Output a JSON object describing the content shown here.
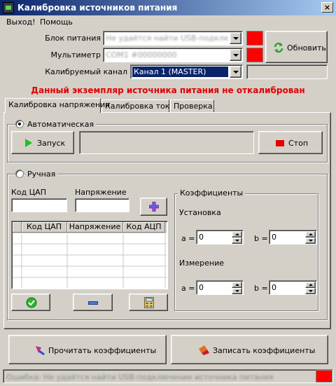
{
  "window": {
    "title": "Калибровка источников питания",
    "close": "×"
  },
  "menu": {
    "items": [
      "Выход!",
      "Помощь"
    ]
  },
  "form": {
    "psu_label": "Блок питания",
    "psu_value": "Не удаётся найти USB-подключение устройства",
    "multimeter_label": "Мультиметр",
    "multimeter_value": "COM1 #00000000",
    "channel_label": "Калибруемый канал",
    "channel_value": "Канал 1 (MASTER)",
    "refresh_label": "Обновить"
  },
  "warning": "Данный экземпляр источника питания не откалиброван",
  "tabs": [
    "Калибровка напряжения",
    "Калибровка тока",
    "Проверка"
  ],
  "auto": {
    "title": "Автоматическая",
    "start_label": "Запуск",
    "stop_label": "Стоп"
  },
  "manual": {
    "title": "Ручная",
    "dac_label": "Код ЦАП",
    "voltage_label": "Напряжение",
    "table_headers": [
      "Код ЦАП",
      "Напряжение",
      "Код АЦП"
    ],
    "coeffs": {
      "title": "Коэффициенты",
      "setup_label": "Установка",
      "measure_label": "Измерение",
      "a_label": "a =",
      "b_label": "b =",
      "setup_a": "0",
      "setup_b": "0",
      "measure_a": "0",
      "measure_b": "0"
    }
  },
  "footer": {
    "read_label": "Прочитать коэффициенты",
    "write_label": "Записать коэффициенты"
  },
  "status": {
    "text": "Ошибка: Не удаётся найти USB-подключение источника питания"
  },
  "colors": {
    "indicator_red": "#ff0000",
    "warning_red": "#e00000",
    "selection": "#0a246a"
  }
}
